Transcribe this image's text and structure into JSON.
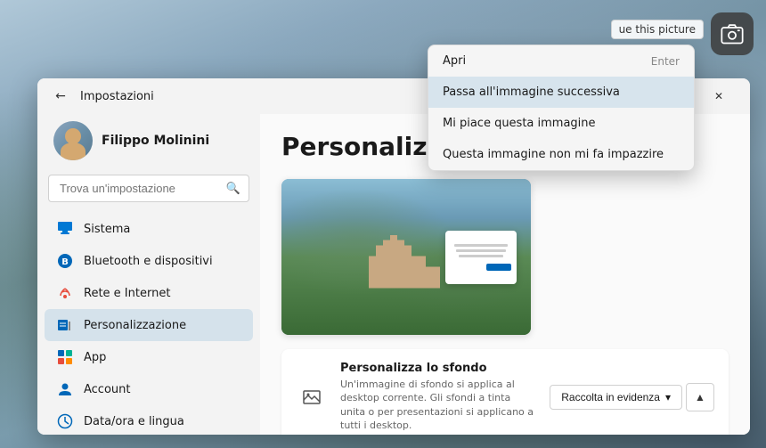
{
  "window": {
    "title": "Impostazioni",
    "back_label": "←",
    "minimize_label": "—",
    "maximize_label": "□",
    "close_label": "✕"
  },
  "user": {
    "name": "Filippo Molinini"
  },
  "search": {
    "placeholder": "Trova un'impostazione",
    "icon": "🔍"
  },
  "sidebar": {
    "items": [
      {
        "id": "sistema",
        "label": "Sistema",
        "icon": "sistema"
      },
      {
        "id": "bluetooth",
        "label": "Bluetooth e dispositivi",
        "icon": "bluetooth"
      },
      {
        "id": "rete",
        "label": "Rete e Internet",
        "icon": "rete"
      },
      {
        "id": "personalizzazione",
        "label": "Personalizzazione",
        "icon": "personalizzazione",
        "active": true
      },
      {
        "id": "app",
        "label": "App",
        "icon": "app"
      },
      {
        "id": "account",
        "label": "Account",
        "icon": "account"
      },
      {
        "id": "data",
        "label": "Data/ora e lingua",
        "icon": "data"
      }
    ]
  },
  "main": {
    "page_title": "Personalizza",
    "settings_card": {
      "title": "Personalizza lo sfondo",
      "description": "Un'immagine di sfondo si applica al desktop corrente. Gli sfondi a tinta unita o per presentazioni si applicano a tutti i desktop.",
      "dropdown_label": "Raccolta in evidenza",
      "expand_icon": "▲"
    }
  },
  "context_menu": {
    "items": [
      {
        "id": "apri",
        "label": "Apri",
        "shortcut": "Enter"
      },
      {
        "id": "prossima",
        "label": "Passa all'immagine successiva",
        "shortcut": "",
        "active": true
      },
      {
        "id": "piace",
        "label": "Mi piace questa immagine",
        "shortcut": ""
      },
      {
        "id": "nonpiace",
        "label": "Questa immagine non mi fa impazzire",
        "shortcut": ""
      }
    ]
  },
  "capture_icon": {
    "tooltip": "ue this picture"
  },
  "preview_card": {
    "lines": [
      70,
      85,
      65,
      55
    ],
    "btn_label": ""
  }
}
